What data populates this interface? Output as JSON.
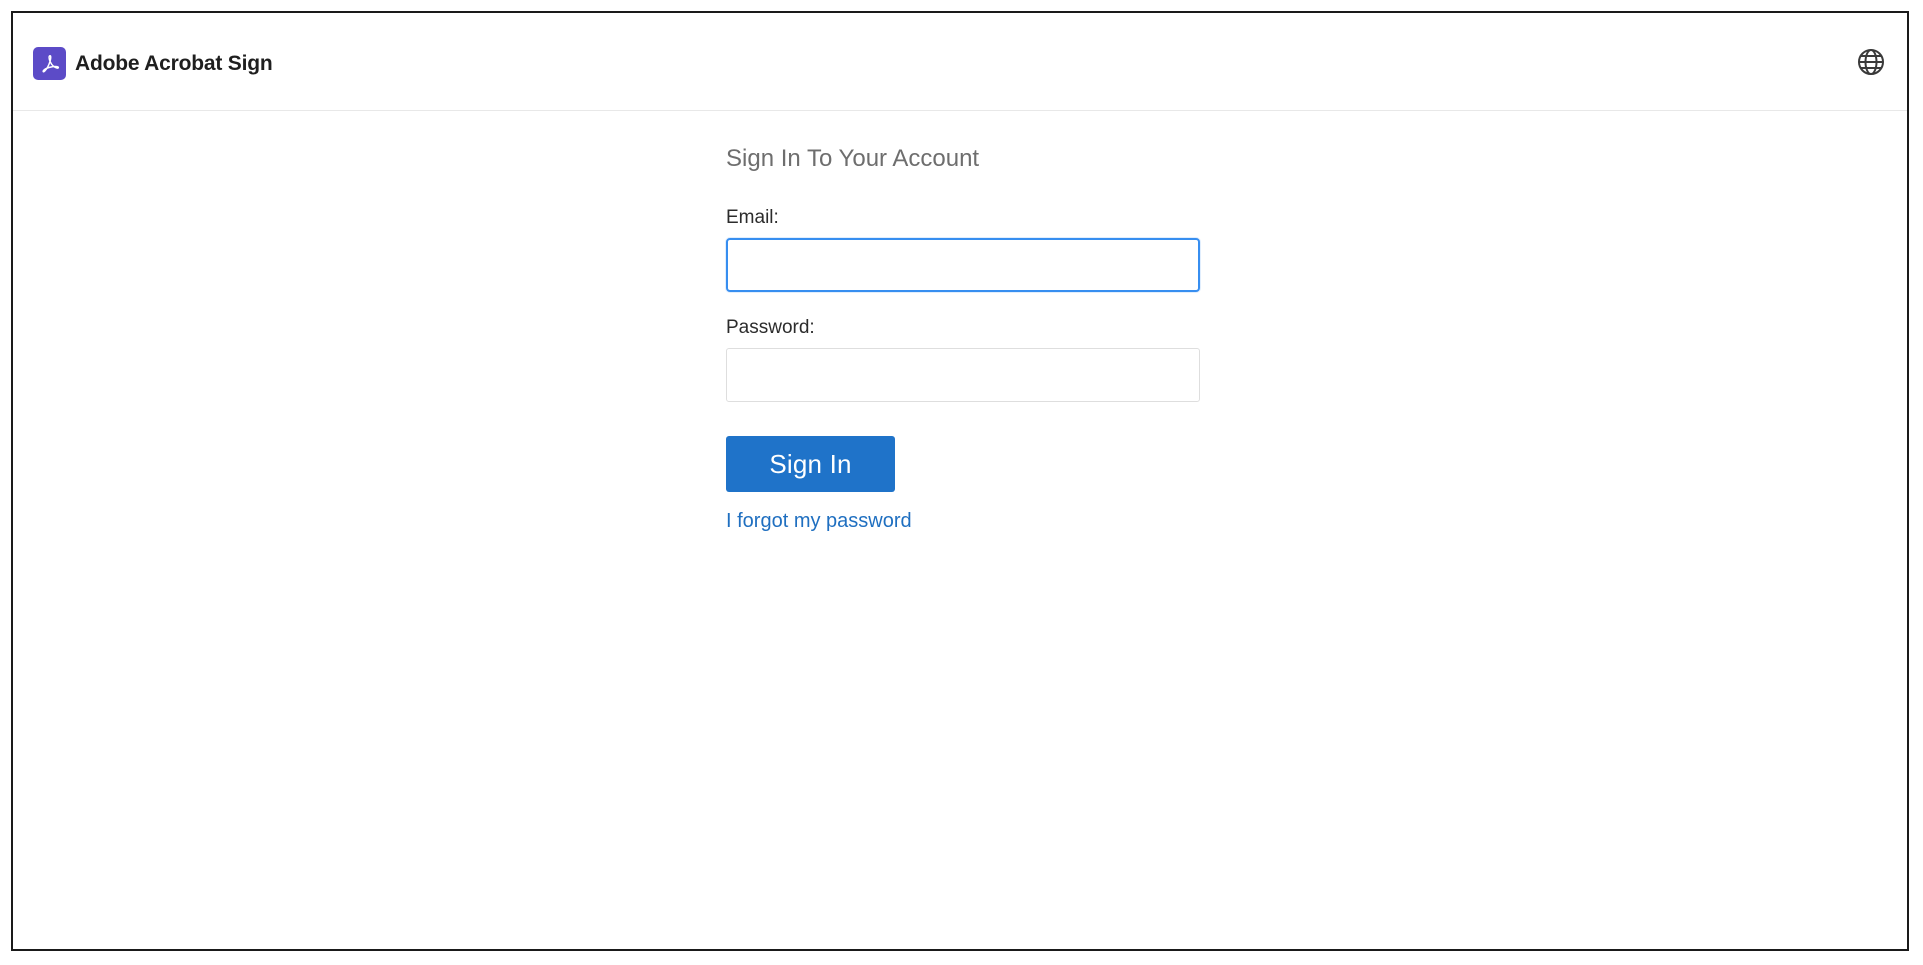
{
  "header": {
    "brand_name": "Adobe Acrobat Sign",
    "logo_icon": "acrobat-logo-icon",
    "language_icon": "globe-icon",
    "brand_color": "#5c4bc7"
  },
  "form": {
    "title": "Sign In To Your Account",
    "email_label": "Email:",
    "email_value": "",
    "password_label": "Password:",
    "password_value": "",
    "submit_label": "Sign In",
    "forgot_link": "I forgot my password",
    "accent_color": "#1f73c9",
    "focus_color": "#378ef0"
  }
}
